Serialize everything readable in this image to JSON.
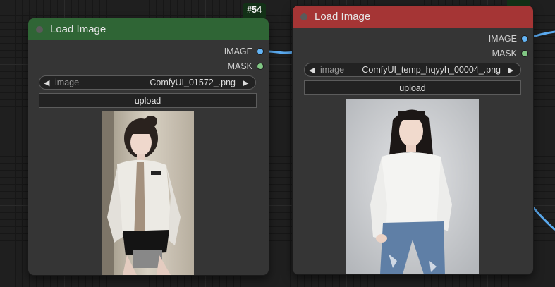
{
  "nodes": [
    {
      "id": "#54",
      "title": "Load Image",
      "header_color": "#2f6535",
      "outputs": [
        {
          "label": "IMAGE",
          "color": "#64b5f6"
        },
        {
          "label": "MASK",
          "color": "#81c784"
        }
      ],
      "widget": {
        "label": "image",
        "value": "ComfyUI_01572_.png"
      },
      "button_label": "upload",
      "preview_icon": "image-preview-woman-white-shirt-tie"
    },
    {
      "id": "#17",
      "title": "Load Image",
      "header_color": "#a53535",
      "outputs": [
        {
          "label": "IMAGE",
          "color": "#64b5f6"
        },
        {
          "label": "MASK",
          "color": "#81c784"
        }
      ],
      "widget": {
        "label": "image",
        "value": "ComfyUI_temp_hqyyh_00004_.png"
      },
      "button_label": "upload",
      "preview_icon": "image-preview-woman-white-sweater-jeans"
    }
  ],
  "link_color": "#64b5f6"
}
